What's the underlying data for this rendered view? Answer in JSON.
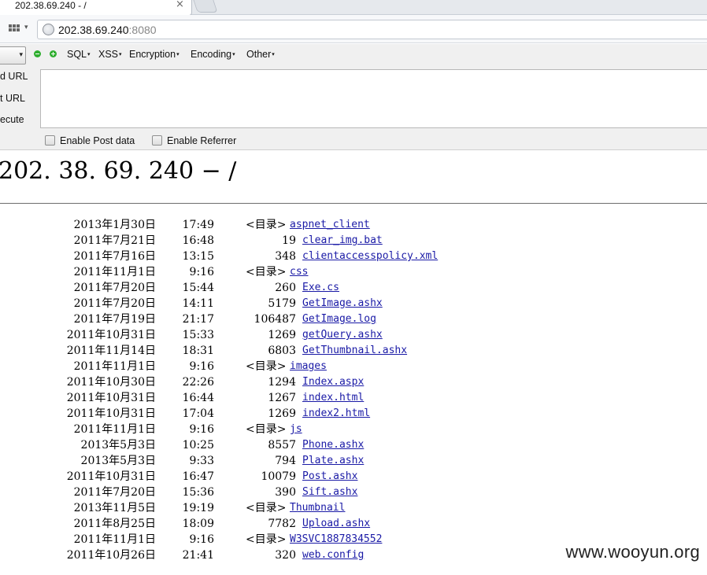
{
  "browser": {
    "tab_title": "202.38.69.240 - /",
    "tab_close": "×",
    "url_host": "202.38.69.240",
    "url_port": ":8080"
  },
  "hackbar": {
    "dropdown_arrow": "▾",
    "menus": [
      "SQL",
      "XSS",
      "Encryption",
      "Encoding",
      "Other"
    ],
    "caret": "▾",
    "side_buttons": [
      "d URL",
      "t URL",
      "ecute"
    ],
    "enable_post": "Enable Post data",
    "enable_referrer": "Enable Referrer"
  },
  "page": {
    "title": "202. 38. 69. 240 − /",
    "dir_label": "<目录>",
    "entries": [
      {
        "date": "2013年1月30日",
        "time": "17:49",
        "size": "",
        "is_dir": true,
        "name": "aspnet_client"
      },
      {
        "date": "2011年7月21日",
        "time": "16:48",
        "size": "19",
        "is_dir": false,
        "name": "clear_img.bat"
      },
      {
        "date": "2011年7月16日",
        "time": "13:15",
        "size": "348",
        "is_dir": false,
        "name": "clientaccesspolicy.xml"
      },
      {
        "date": "2011年11月1日",
        "time": "9:16",
        "size": "",
        "is_dir": true,
        "name": "css"
      },
      {
        "date": "2011年7月20日",
        "time": "15:44",
        "size": "260",
        "is_dir": false,
        "name": "Exe.cs"
      },
      {
        "date": "2011年7月20日",
        "time": "14:11",
        "size": "5179",
        "is_dir": false,
        "name": "GetImage.ashx"
      },
      {
        "date": "2011年7月19日",
        "time": "21:17",
        "size": "106487",
        "is_dir": false,
        "name": "GetImage.log"
      },
      {
        "date": "2011年10月31日",
        "time": "15:33",
        "size": "1269",
        "is_dir": false,
        "name": "getQuery.ashx"
      },
      {
        "date": "2011年11月14日",
        "time": "18:31",
        "size": "6803",
        "is_dir": false,
        "name": "GetThumbnail.ashx"
      },
      {
        "date": "2011年11月1日",
        "time": "9:16",
        "size": "",
        "is_dir": true,
        "name": "images"
      },
      {
        "date": "2011年10月30日",
        "time": "22:26",
        "size": "1294",
        "is_dir": false,
        "name": "Index.aspx"
      },
      {
        "date": "2011年10月31日",
        "time": "16:44",
        "size": "1267",
        "is_dir": false,
        "name": "index.html"
      },
      {
        "date": "2011年10月31日",
        "time": "17:04",
        "size": "1269",
        "is_dir": false,
        "name": "index2.html"
      },
      {
        "date": "2011年11月1日",
        "time": "9:16",
        "size": "",
        "is_dir": true,
        "name": "js"
      },
      {
        "date": "2013年5月3日",
        "time": "10:25",
        "size": "8557",
        "is_dir": false,
        "name": "Phone.ashx"
      },
      {
        "date": "2013年5月3日",
        "time": "9:33",
        "size": "794",
        "is_dir": false,
        "name": "Plate.ashx"
      },
      {
        "date": "2011年10月31日",
        "time": "16:47",
        "size": "10079",
        "is_dir": false,
        "name": "Post.ashx"
      },
      {
        "date": "2011年7月20日",
        "time": "15:36",
        "size": "390",
        "is_dir": false,
        "name": "Sift.ashx"
      },
      {
        "date": "2013年11月5日",
        "time": "19:19",
        "size": "",
        "is_dir": true,
        "name": "Thumbnail"
      },
      {
        "date": "2011年8月25日",
        "time": "18:09",
        "size": "7782",
        "is_dir": false,
        "name": "Upload.ashx"
      },
      {
        "date": "2011年11月1日",
        "time": "9:16",
        "size": "",
        "is_dir": true,
        "name": "W3SVC1887834552"
      },
      {
        "date": "2011年10月26日",
        "time": "21:41",
        "size": "320",
        "is_dir": false,
        "name": "web.config"
      }
    ]
  },
  "watermark": "www.wooyun.org"
}
